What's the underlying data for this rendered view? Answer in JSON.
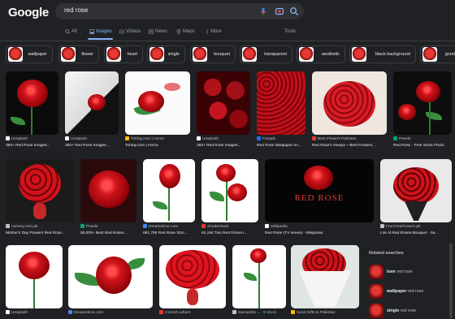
{
  "header": {
    "logo": "Google",
    "query": "red rose",
    "mic_icon": "microphone-icon",
    "lens_icon": "lens-icon",
    "search_icon": "search-icon"
  },
  "tabs": [
    {
      "label": "All",
      "icon": "search-icon"
    },
    {
      "label": "Images",
      "icon": "image-icon",
      "active": true
    },
    {
      "label": "Videos",
      "icon": "video-icon"
    },
    {
      "label": "News",
      "icon": "news-icon"
    },
    {
      "label": "Maps",
      "icon": "map-icon"
    },
    {
      "label": "More",
      "icon": "more-icon"
    }
  ],
  "tools_label": "Tools",
  "chips": [
    "wallpaper",
    "flower",
    "heart",
    "single",
    "bouquet",
    "transparent",
    "aesthetic",
    "black background",
    "good"
  ],
  "row1": [
    {
      "source": "Unsplash",
      "title": "350+ Red Rose Images..."
    },
    {
      "source": "Unsplash",
      "title": "350+ Red Rose Images..."
    },
    {
      "source": "Tohfay.com | Home",
      "title": "Tohfay.com | Home"
    },
    {
      "source": "Unsplash",
      "title": "350+ Red Rose Images..."
    },
    {
      "source": "Freepik",
      "title": "Red Rose Wallpaper Im..."
    },
    {
      "source": "Best Flowers Pakistan",
      "title": "Red Rose's Always ~ Best Flowers..."
    },
    {
      "source": "Pexels",
      "title": "Red Rose · Free Stock Photo"
    }
  ],
  "row2": [
    {
      "source": "nursery.com.pk",
      "title": "Mother's Day Flowers Red Rose..."
    },
    {
      "source": "Pexels",
      "title": "50,000+ Best Red Roses ..."
    },
    {
      "source": "Dreamstime.com",
      "title": "681,755 Red Rose Stoc..."
    },
    {
      "source": "Shutterstock",
      "title": "62,194 Two Red Roses I..."
    },
    {
      "source": "Wikipedia",
      "title": "Red Rose (TV series) - Wikipedia",
      "overlay": "RED ROSE"
    },
    {
      "source": "FromYouFlowers.pk",
      "title": "Life of Red Roses Bouquet - Sa..."
    }
  ],
  "row3": [
    {
      "source": "Unsplash"
    },
    {
      "source": "Dreamstime.com"
    },
    {
      "source": "Cornell Lahore"
    },
    {
      "source": "Samantha ...",
      "badge": "In stock"
    },
    {
      "source": "Send Gifts to Pakistan"
    }
  ],
  "related": {
    "heading": "Related searches",
    "items": [
      {
        "bold": "love",
        "rest": " red rose"
      },
      {
        "bold": "wallpaper",
        "rest": " red rose"
      },
      {
        "bold": "single",
        "rest": " red rose"
      }
    ]
  },
  "colors": {
    "bg": "#202124",
    "accent": "#8ab4f8",
    "rose": "#d0131b",
    "stock_green": "#81c995"
  }
}
